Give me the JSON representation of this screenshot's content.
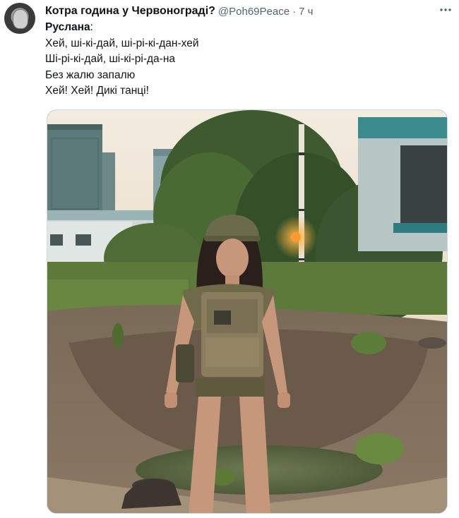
{
  "tweet": {
    "author_name": "Котра година у Червонограді?",
    "handle": "@Poh69Peace",
    "separator": "·",
    "time": "7 ч",
    "more_icon": "more-horizontal-icon",
    "speaker": "Руслана",
    "speaker_colon": ":",
    "lines": [
      "Хей, ші-кі-дай, ші-рі-кі-дан-хей",
      "Ші-рі-кі-дай, ші-кі-рі-да-на",
      "Без жалю запалю",
      "Хей! Хей! Дикі танці!"
    ]
  },
  "colors": {
    "text": "#0f1419",
    "secondary": "#536471",
    "border": "#cfd9de"
  }
}
